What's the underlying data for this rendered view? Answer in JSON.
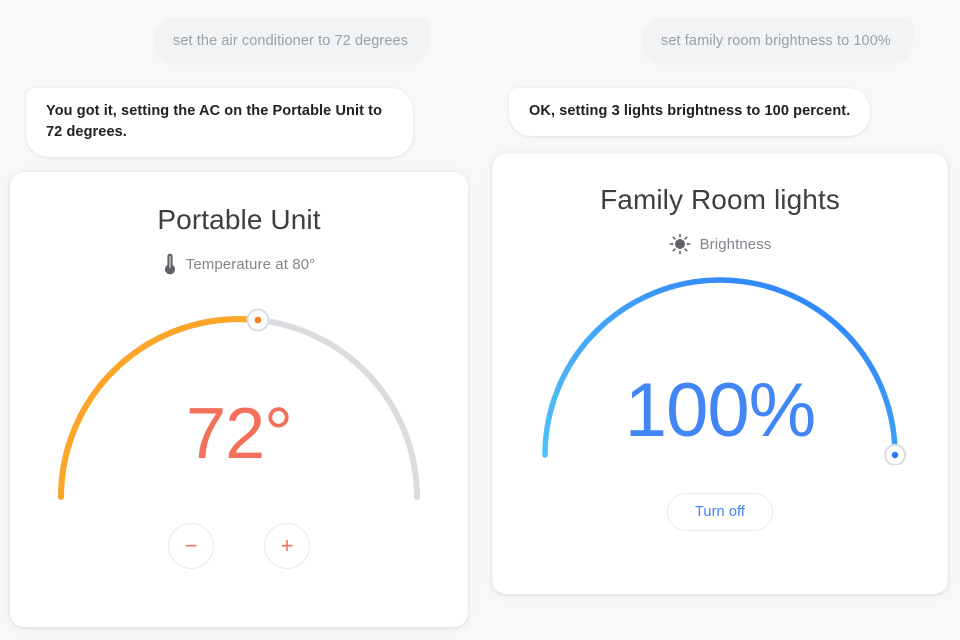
{
  "page": {
    "background_color": "#f7f8fa"
  },
  "left_panel": {
    "conversation": {
      "user_message": "set the air conditioner to 72 degrees",
      "assistant_message": "You got it, setting the AC on the Portable Unit to 72 degrees."
    },
    "card": {
      "title": "Portable Unit",
      "status_icon": "thermometer-icon",
      "status_label": "Temperature at 80°",
      "dial": {
        "value_label": "72°",
        "value": 72,
        "unit": "degrees",
        "ambient_temperature": 80,
        "track_color": "#dadce0",
        "progress_color": "#fba529",
        "knob_dot_color": "#f48120",
        "fill_fraction": 0.56
      },
      "decrease_button_label": "−",
      "increase_button_label": "+",
      "accent_color": "#f4705a"
    }
  },
  "right_panel": {
    "conversation": {
      "user_message": "set family room brightness to 100%",
      "assistant_message": "OK, setting 3 lights brightness to 100 percent."
    },
    "card": {
      "title": "Family Room lights",
      "status_icon": "brightness-sun-icon",
      "status_label": "Brightness",
      "dial": {
        "value_label": "100%",
        "value": 100,
        "unit": "percent",
        "progress_color_start": "#4fc3f7",
        "progress_color_end": "#2979ff",
        "knob_dot_color": "#2979ff",
        "fill_fraction": 1.0
      },
      "turn_off_button_label": "Turn off",
      "accent_color": "#4285f4"
    }
  }
}
